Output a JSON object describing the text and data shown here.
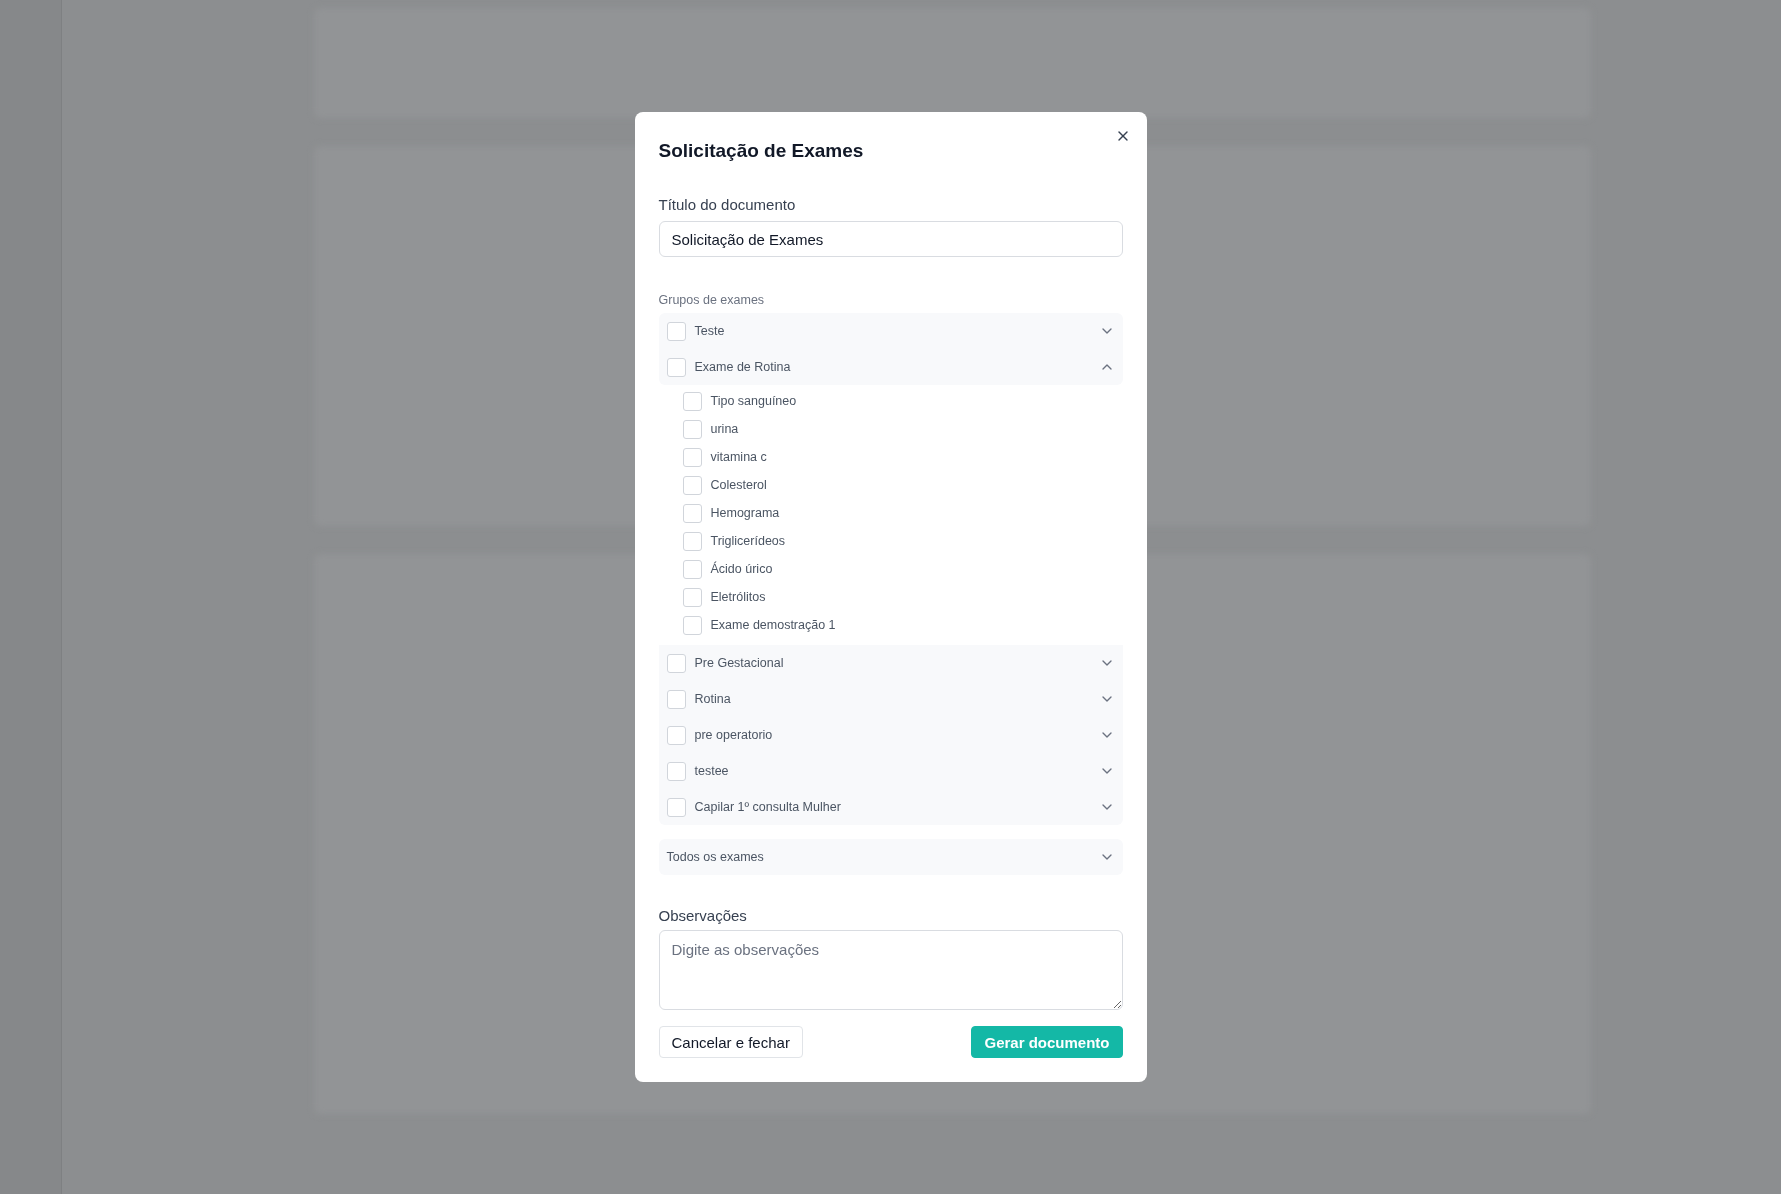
{
  "dialog": {
    "title": "Solicitação de Exames",
    "document_title": {
      "label": "Título do documento",
      "value": "Solicitação de Exames"
    },
    "groups_label": "Grupos de exames",
    "groups": [
      {
        "name": "Teste",
        "checked": false,
        "expanded": false
      },
      {
        "name": "Exame de Rotina",
        "checked": false,
        "expanded": true,
        "children": [
          {
            "name": "Tipo sanguíneo",
            "checked": false
          },
          {
            "name": "urina",
            "checked": false
          },
          {
            "name": "vitamina c",
            "checked": false
          },
          {
            "name": "Colesterol",
            "checked": false
          },
          {
            "name": "Hemograma",
            "checked": false
          },
          {
            "name": "Triglicerídeos",
            "checked": false
          },
          {
            "name": "Ácido úrico",
            "checked": false
          },
          {
            "name": "Eletrólitos",
            "checked": false
          },
          {
            "name": "Exame demostração 1",
            "checked": false
          }
        ]
      },
      {
        "name": "Pre Gestacional",
        "checked": false,
        "expanded": false
      },
      {
        "name": "Rotina",
        "checked": false,
        "expanded": false
      },
      {
        "name": "pre operatorio",
        "checked": false,
        "expanded": false
      },
      {
        "name": "testee",
        "checked": false,
        "expanded": false
      },
      {
        "name": "Capilar 1º consulta Mulher",
        "checked": false,
        "expanded": false
      }
    ],
    "all_exams": {
      "label": "Todos os exames",
      "expanded": false
    },
    "notes": {
      "label": "Observações",
      "placeholder": "Digite as observações"
    },
    "buttons": [
      {
        "label": "Cancelar e fechar",
        "kind": "secondary"
      },
      {
        "label": "Gerar documento",
        "kind": "primary"
      }
    ]
  }
}
